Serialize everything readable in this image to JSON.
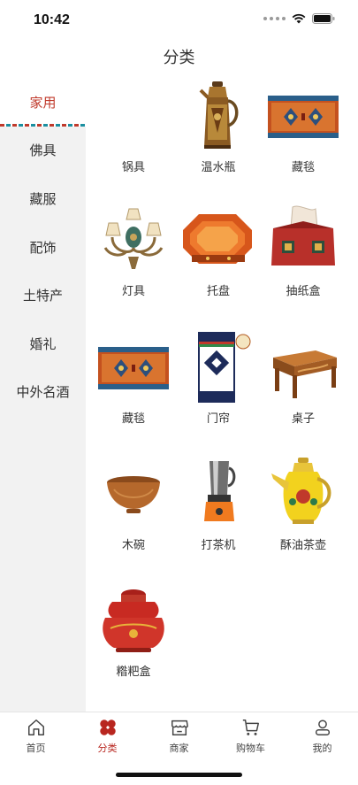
{
  "status_bar": {
    "time": "10:42"
  },
  "header": {
    "title": "分类"
  },
  "sidebar": {
    "items": [
      {
        "label": "家用",
        "active": true
      },
      {
        "label": "佛具"
      },
      {
        "label": "藏服"
      },
      {
        "label": "配饰"
      },
      {
        "label": "土特产"
      },
      {
        "label": "婚礼"
      },
      {
        "label": "中外名酒"
      }
    ]
  },
  "products": [
    {
      "label": "锅具",
      "icon": "pot-image"
    },
    {
      "label": "温水瓶",
      "icon": "thermos-image"
    },
    {
      "label": "藏毯",
      "icon": "tibetan-rug-image"
    },
    {
      "label": "灯具",
      "icon": "chandelier-image"
    },
    {
      "label": "托盘",
      "icon": "tray-image"
    },
    {
      "label": "抽纸盒",
      "icon": "tissue-box-image"
    },
    {
      "label": "藏毯",
      "icon": "tibetan-rug-image"
    },
    {
      "label": "门帘",
      "icon": "door-curtain-image"
    },
    {
      "label": "桌子",
      "icon": "table-image"
    },
    {
      "label": "木碗",
      "icon": "wooden-bowl-image"
    },
    {
      "label": "打茶机",
      "icon": "tea-machine-image"
    },
    {
      "label": "酥油茶壶",
      "icon": "butter-tea-pot-image"
    },
    {
      "label": "糌粑盒",
      "icon": "tsampa-box-image"
    }
  ],
  "tabbar": {
    "tabs": [
      {
        "label": "首页",
        "icon": "home-icon"
      },
      {
        "label": "分类",
        "icon": "category-icon",
        "active": true
      },
      {
        "label": "商家",
        "icon": "store-icon"
      },
      {
        "label": "购物车",
        "icon": "cart-icon"
      },
      {
        "label": "我的",
        "icon": "profile-icon"
      }
    ]
  },
  "colors": {
    "accent": "#b8261f",
    "sidebar_bg": "#f2f2f2"
  }
}
